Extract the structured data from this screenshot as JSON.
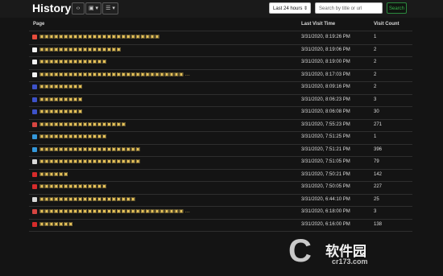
{
  "header": {
    "title": "History",
    "tools": [
      {
        "name": "code-view-button",
        "label": "‹›"
      },
      {
        "name": "export-button",
        "label": "▣ ▾"
      },
      {
        "name": "filter-button",
        "label": "☰ ▾"
      }
    ],
    "range_select": {
      "value": "Last 24 hours ⇕"
    },
    "search": {
      "placeholder": "Search by title or url"
    },
    "search_button_label": "Search"
  },
  "table": {
    "columns": [
      "Page",
      "Last Visit Time",
      "Visit Count"
    ],
    "rows": [
      {
        "icon": "#e74c3c",
        "title": "▣▣▣▣▣▣▣▣▣▣▣▣▣▣▣▣▣▣▣▣▣▣▣▣▣",
        "time": "3/31/2020, 8:19:26 PM",
        "count": "1"
      },
      {
        "icon": "#f2f2f2",
        "title": "▣▣▣▣▣▣▣▣▣▣▣▣▣▣▣▣▣",
        "time": "3/31/2020, 8:19:06 PM",
        "count": "2"
      },
      {
        "icon": "#f2f2f2",
        "title": "▣▣▣▣▣▣▣▣▣▣▣▣▣▣",
        "time": "3/31/2020, 8:19:00 PM",
        "count": "2"
      },
      {
        "icon": "#f2f2f2",
        "title": "▣▣▣▣▣▣▣▣▣▣▣▣▣▣▣▣▣▣▣▣▣▣▣▣▣▣▣▣▣▣ ...",
        "time": "3/31/2020, 8:17:03 PM",
        "count": "2"
      },
      {
        "icon": "#3d52c9",
        "title": "▣▣▣▣▣▣▣▣▣",
        "time": "3/31/2020, 8:09:16 PM",
        "count": "2"
      },
      {
        "icon": "#3d52c9",
        "title": "▣▣▣▣▣▣▣▣▣",
        "time": "3/31/2020, 8:06:23 PM",
        "count": "3"
      },
      {
        "icon": "#3d52c9",
        "title": "▣▣▣▣▣▣▣▣▣",
        "time": "3/31/2020, 8:06:08 PM",
        "count": "30"
      },
      {
        "icon": "#d64541",
        "title": "▣▣▣▣▣▣▣▣▣▣▣▣▣▣▣▣▣▣",
        "time": "3/31/2020, 7:55:23 PM",
        "count": "271"
      },
      {
        "icon": "#3498db",
        "title": "▣▣▣▣▣▣▣▣▣▣▣▣▣▣",
        "time": "3/31/2020, 7:51:25 PM",
        "count": "1"
      },
      {
        "icon": "#3498db",
        "title": "▣▣▣▣▣▣▣▣▣▣▣▣▣▣▣▣▣▣▣▣▣",
        "time": "3/31/2020, 7:51:21 PM",
        "count": "396"
      },
      {
        "icon": "#d9d9d9",
        "title": "▣▣▣▣▣▣▣▣▣▣▣▣▣▣▣▣▣▣▣▣▣",
        "time": "3/31/2020, 7:51:05 PM",
        "count": "79"
      },
      {
        "icon": "#d62b2b",
        "title": "▣▣▣▣▣▣",
        "time": "3/31/2020, 7:50:21 PM",
        "count": "142"
      },
      {
        "icon": "#d62b2b",
        "title": "▣▣▣▣▣▣▣▣▣▣▣▣▣▣",
        "time": "3/31/2020, 7:50:05 PM",
        "count": "227"
      },
      {
        "icon": "#d9d9d9",
        "title": "▣▣▣▣▣▣▣▣▣▣▣▣▣▣▣▣▣▣▣▣",
        "time": "3/31/2020, 6:44:10 PM",
        "count": "25"
      },
      {
        "icon": "#d64541",
        "title": "▣▣▣▣▣▣▣▣▣▣▣▣▣▣▣▣▣▣▣▣▣▣▣▣▣▣▣▣▣▣ ...",
        "time": "3/31/2020, 6:18:00 PM",
        "count": "3"
      },
      {
        "icon": "#d62b2b",
        "title": "▣▣▣▣▣▣▣",
        "time": "3/31/2020, 6:16:00 PM",
        "count": "138"
      }
    ]
  },
  "watermark": {
    "logo_text": "C",
    "main": "软件园",
    "sub": "cr173.com"
  }
}
